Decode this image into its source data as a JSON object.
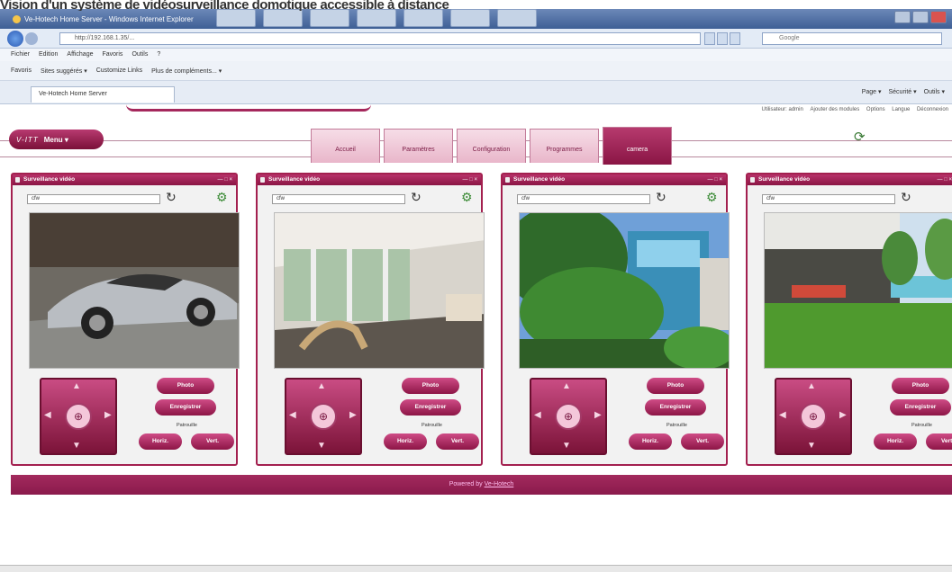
{
  "caption_text": "Vision d'un système de vidéosurveillance domotique accessible à distance",
  "window": {
    "title": "Ve-Hotech Home Server - Windows Internet Explorer"
  },
  "address": {
    "url": "http://192.168.1.35/...",
    "search_placeholder": "Google"
  },
  "menubar": [
    "Fichier",
    "Edition",
    "Affichage",
    "Favoris",
    "Outils",
    "?"
  ],
  "favbar": [
    "Favoris",
    "Sites suggérés ▾",
    "Customize Links",
    "Plus de compléments... ▾"
  ],
  "browser_tab": "Ve-Hotech Home Server",
  "ie_tools": [
    "Page ▾",
    "Sécurité ▾",
    "Outils ▾"
  ],
  "user_links": [
    "Utilisateur: admin",
    "Ajouter des modules",
    "Options",
    "Langue",
    "Déconnexion"
  ],
  "menu": {
    "logo": "V-ITT",
    "label": "Menu ▾"
  },
  "nav_tabs": [
    "Accueil",
    "Paramètres",
    "Configuration",
    "Programmes",
    "camera"
  ],
  "panel": {
    "title": "Surveillance vidéo",
    "select_value": "cfw",
    "photo": "Photo",
    "record": "Enregistrer",
    "patrol": "Patrouille",
    "horiz": "Horiz.",
    "vert": "Vert."
  },
  "footer": {
    "prefix": "Powered by",
    "link": "Ve-Hotech"
  }
}
